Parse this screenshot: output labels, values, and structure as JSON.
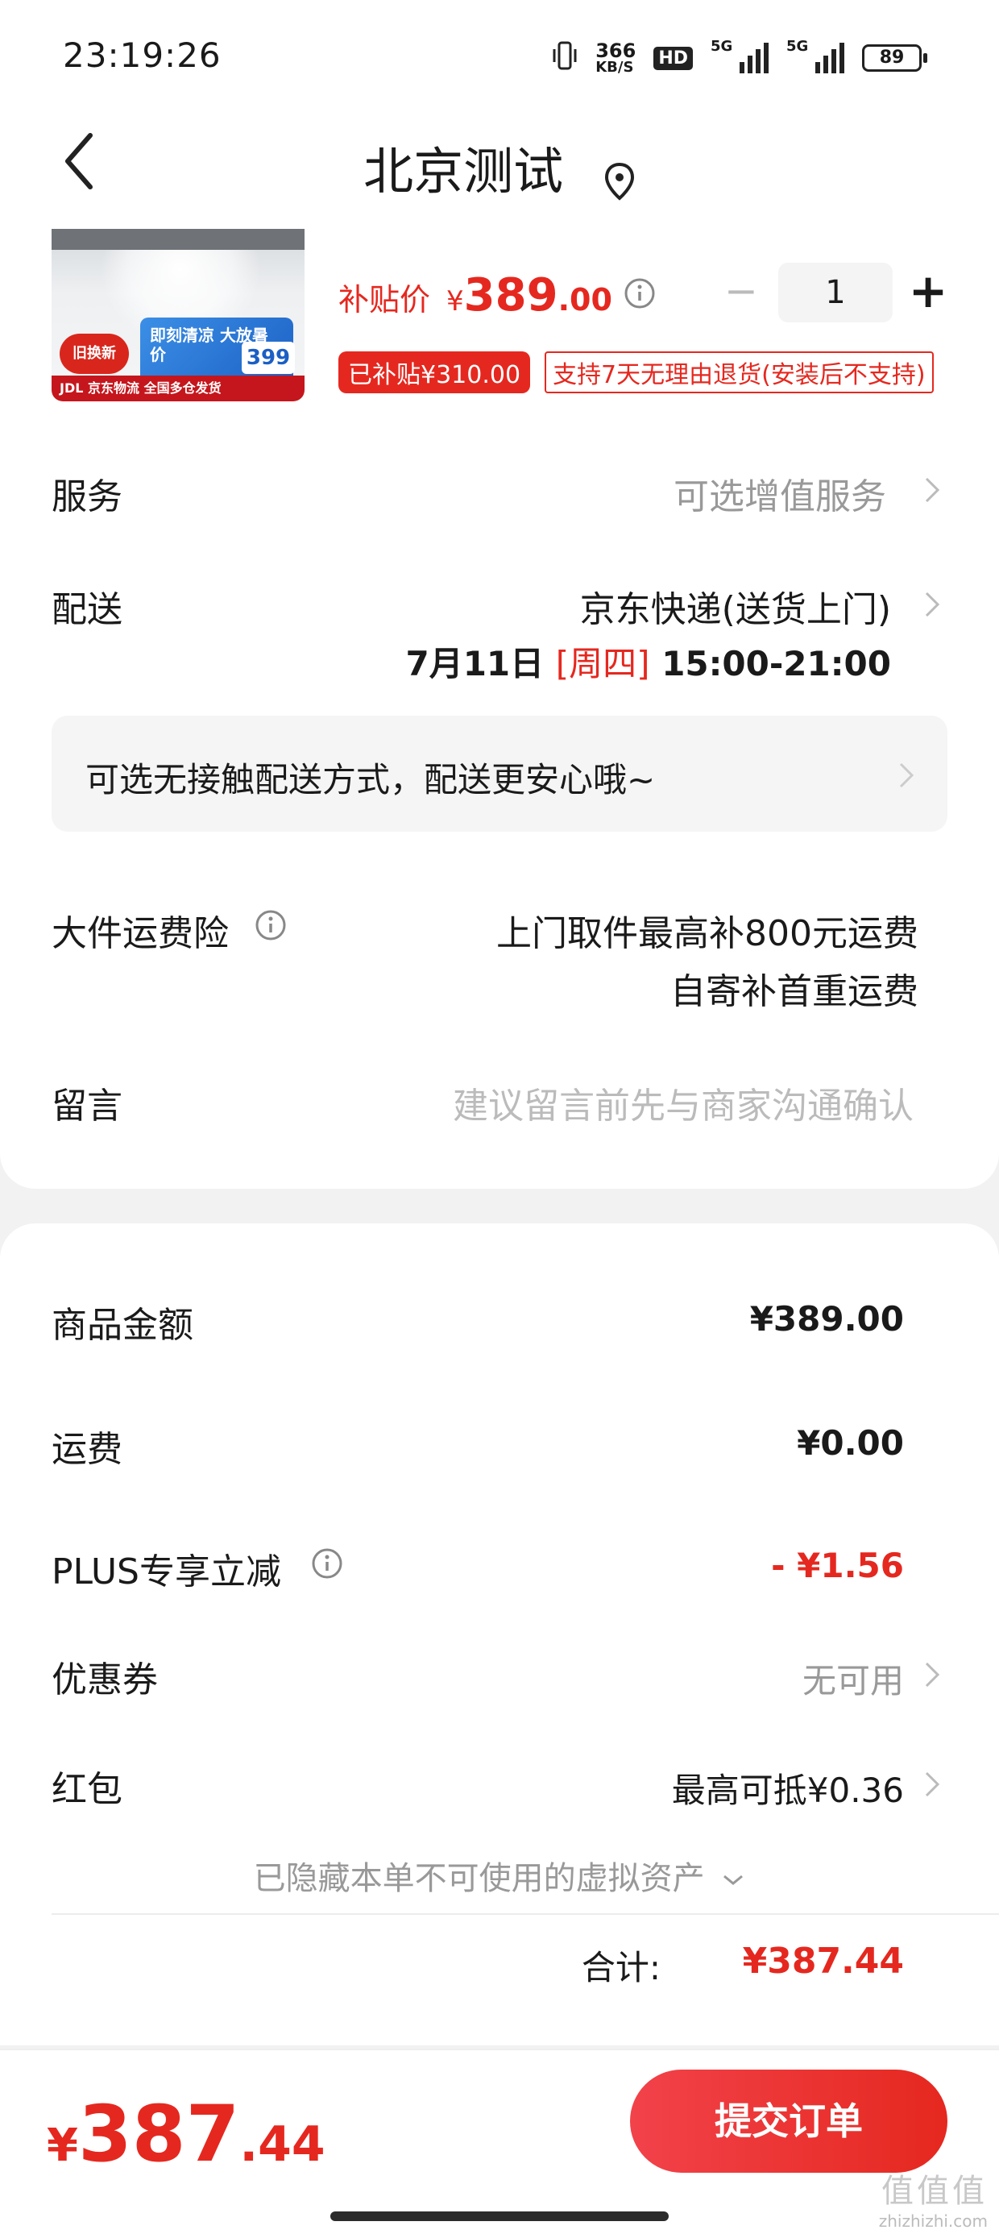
{
  "status_bar": {
    "time": "23:19:26",
    "net_speed_value": "366",
    "net_speed_unit": "KB/S",
    "hd_label": "HD",
    "signal1_label": "5G",
    "signal2_label": "5G",
    "battery_level": "89"
  },
  "header": {
    "title": "北京测试"
  },
  "product": {
    "price_label": "补贴价",
    "price_currency": "¥",
    "price_integer": "389",
    "price_decimal": ".00",
    "quantity": "1",
    "subsidy_tag": "已补贴¥310.00",
    "return_tag": "支持7天无理由退货(安装后不支持)",
    "image_badge_text": "旧换新",
    "image_banner_text": "即刻清凉 大放暑价",
    "image_price_text": "399",
    "image_footer_text": "JDL 京东物流 全国多仓发货"
  },
  "service": {
    "label": "服务",
    "value": "可选增值服务"
  },
  "delivery": {
    "label": "配送",
    "method": "京东快递(送货上门)",
    "date": "7月11日",
    "weekday": "[周四]",
    "time_range": "15:00-21:00"
  },
  "notice": {
    "text": "可选无接触配送方式，配送更安心哦~"
  },
  "freight_insurance": {
    "label": "大件运费险",
    "line1": "上门取件最高补800元运费",
    "line2": "自寄补首重运费"
  },
  "message": {
    "label": "留言",
    "placeholder": "建议留言前先与商家沟通确认"
  },
  "summary": {
    "goods_label": "商品金额",
    "goods_value": "¥389.00",
    "shipping_label": "运费",
    "shipping_value": "¥0.00",
    "plus_label": "PLUS专享立减",
    "plus_value": "- ¥1.56",
    "coupon_label": "优惠券",
    "coupon_value": "无可用",
    "redpacket_label": "红包",
    "redpacket_value": "最高可抵¥0.36",
    "hidden_assets": "已隐藏本单不可使用的虚拟资产",
    "total_label": "合计:",
    "total_value": "¥387.44"
  },
  "footer": {
    "pay_currency": "¥",
    "pay_integer": "387",
    "pay_decimal": ".44",
    "submit_label": "提交订单",
    "watermark_glyphs": "值值值",
    "watermark_url": "zhizhizhi.com"
  },
  "colors": {
    "accent": "#e5281f",
    "muted": "#999999",
    "background": "#f2f2f2"
  },
  "icons": [
    "vibrate-icon",
    "signal-icon",
    "battery-icon",
    "back-arrow-icon",
    "location-pin-icon",
    "info-icon",
    "chevron-right-icon",
    "chevron-down-icon"
  ]
}
